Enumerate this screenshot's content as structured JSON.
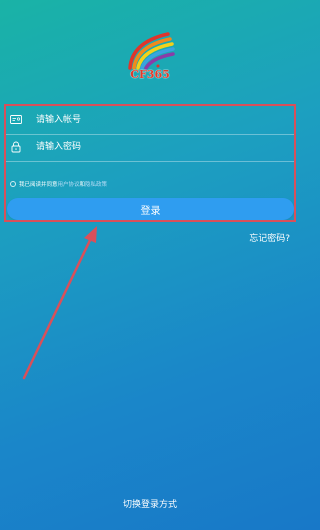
{
  "logo": {
    "text": "CF365"
  },
  "account_field": {
    "icon": "id-card-icon",
    "placeholder": "请输入帐号"
  },
  "password_field": {
    "icon": "lock-icon",
    "placeholder": "请输入密码"
  },
  "agreement": {
    "prefix": "我已阅读并同意",
    "user_agreement": "用户协议",
    "and": "和",
    "privacy_policy": "隐私政策"
  },
  "login_button": {
    "label": "登录"
  },
  "forgot_password": {
    "label": "忘记密码?"
  },
  "switch_login": {
    "label": "切换登录方式"
  },
  "colors": {
    "background_top": "#1ab3a6",
    "background_bottom": "#1878c8",
    "button": "#2f9df0",
    "annotation": "#d9505a"
  }
}
